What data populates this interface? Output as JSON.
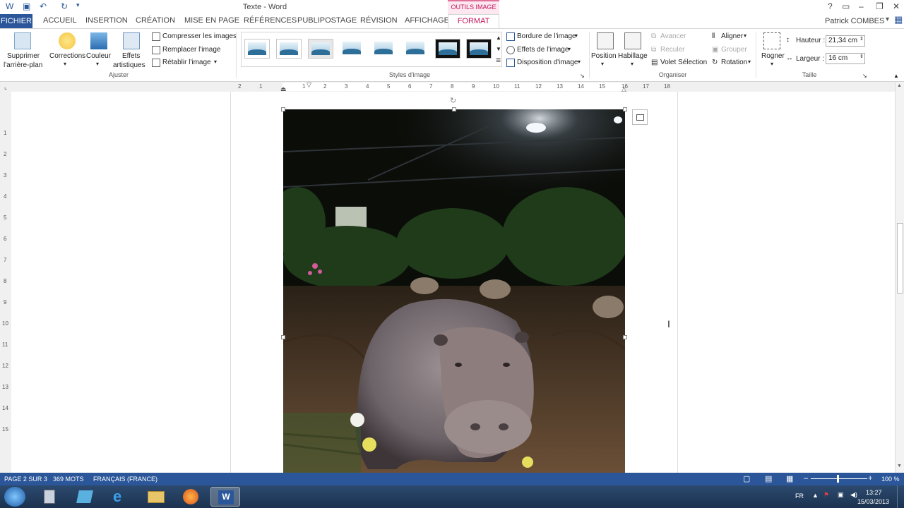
{
  "window": {
    "title": "Texte - Word",
    "context_tool": "OUTILS IMAGE"
  },
  "tabs": [
    "FICHIER",
    "ACCUEIL",
    "INSERTION",
    "CRÉATION",
    "MISE EN PAGE",
    "RÉFÉRENCES",
    "PUBLIPOSTAGE",
    "RÉVISION",
    "AFFICHAGE",
    "FORMAT"
  ],
  "user": "Patrick COMBES",
  "ribbon": {
    "ajuster": {
      "group_label": "Ajuster",
      "remove_bg_1": "Supprimer",
      "remove_bg_2": "l'arrière-plan",
      "corrections": "Corrections",
      "couleur": "Couleur",
      "effets_1": "Effets",
      "effets_2": "artistiques",
      "compresser": "Compresser les images",
      "remplacer": "Remplacer l'image",
      "retablir": "Rétablir l'image"
    },
    "styles": {
      "group_label": "Styles d'image",
      "bordure": "Bordure de l'image",
      "effets": "Effets de l'image",
      "disposition": "Disposition d'image"
    },
    "organiser": {
      "group_label": "Organiser",
      "position": "Position",
      "habillage": "Habillage",
      "avancer": "Avancer",
      "reculer": "Reculer",
      "volet": "Volet Sélection",
      "aligner": "Aligner",
      "grouper": "Grouper",
      "rotation": "Rotation"
    },
    "taille": {
      "group_label": "Taille",
      "rogner": "Rogner",
      "hauteur_label": "Hauteur :",
      "hauteur_value": "21,34 cm",
      "largeur_label": "Largeur :",
      "largeur_value": "16 cm"
    }
  },
  "ruler": {
    "h": [
      "2",
      "1",
      "1",
      "2",
      "3",
      "4",
      "5",
      "6",
      "7",
      "8",
      "9",
      "10",
      "11",
      "12",
      "13",
      "14",
      "15",
      "16",
      "17",
      "18"
    ],
    "v": [
      "1",
      "2",
      "3",
      "4",
      "5",
      "6",
      "7",
      "8",
      "9",
      "10",
      "11",
      "12",
      "13",
      "14",
      "15"
    ]
  },
  "status": {
    "page": "PAGE 2 SUR 3",
    "words": "369 MOTS",
    "language": "FRANÇAIS (FRANCE)",
    "zoom": "100 %"
  },
  "taskbar": {
    "lang": "FR",
    "time": "13:27",
    "date": "15/03/2013"
  },
  "colors": {
    "word_blue": "#2b579a",
    "picture_tools": "#c2185b"
  }
}
